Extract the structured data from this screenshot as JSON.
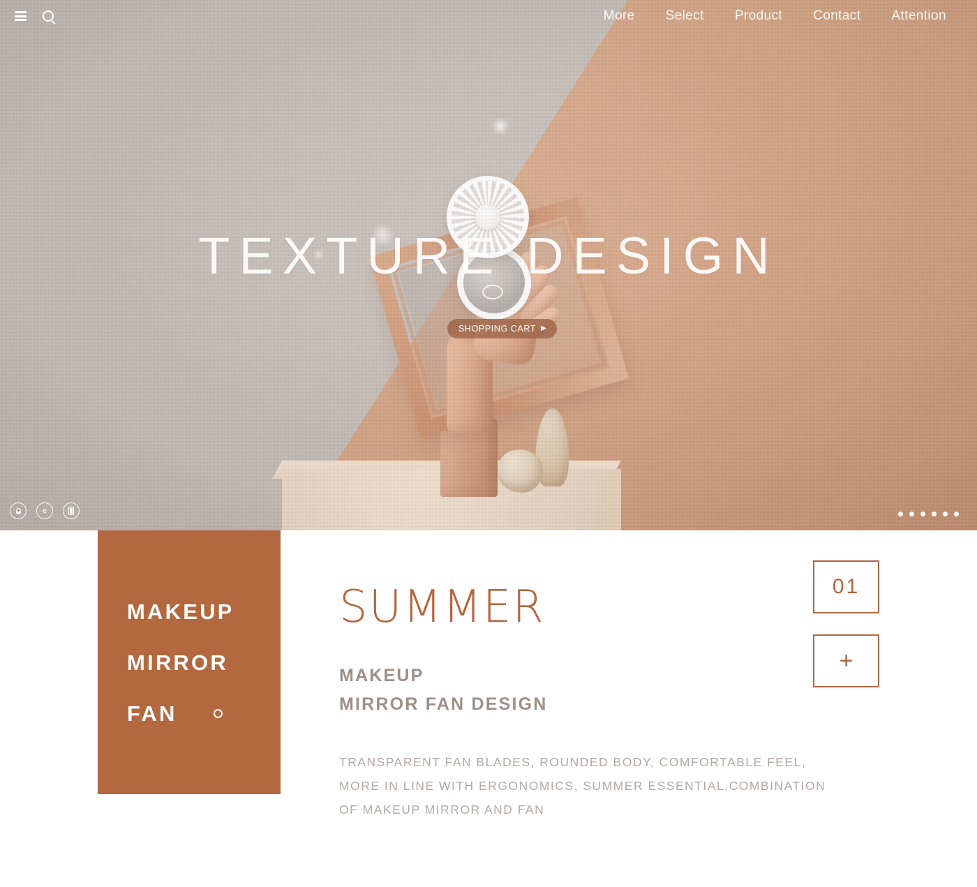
{
  "topbar": {
    "menu_icon": "hamburger-menu-icon",
    "search_icon": "search-icon",
    "nav": [
      {
        "label": "More"
      },
      {
        "label": "Select"
      },
      {
        "label": "Product"
      },
      {
        "label": "Contact"
      },
      {
        "label": "Attention"
      }
    ]
  },
  "hero": {
    "headline": "TEXTURE DESIGN",
    "cart_button": {
      "label": "SHOPPING CART",
      "arrow": "▶"
    },
    "background_left_color": "#C9C0BA",
    "background_right_color": "#DBAE8C",
    "social_icons": [
      {
        "name": "location-pin-icon"
      },
      {
        "name": "globe-e-icon",
        "glyph": "e"
      },
      {
        "name": "phone-icon"
      }
    ],
    "carousel_dots": 6
  },
  "content": {
    "brand_panel": {
      "background_color": "#B3683F",
      "lines": [
        {
          "text": "MAKEUP"
        },
        {
          "text": "MIRROR"
        },
        {
          "text": "FAN"
        }
      ]
    },
    "title": "SUMMER",
    "title_color": "#B5653F",
    "subtitle_lines": [
      "MAKEUP",
      "MIRROR FAN DESIGN"
    ],
    "subtitle_color": "#9C8F88",
    "description_lines": [
      "TRANSPARENT FAN BLADES, ROUNDED BODY, COMFORTABLE FEEL,",
      "MORE IN LINE WITH ERGONOMICS, SUMMER ESSENTIAL,COMBINATION",
      "OF MAKEUP MIRROR AND FAN"
    ],
    "side_boxes": {
      "index": "01",
      "add": "+"
    }
  }
}
